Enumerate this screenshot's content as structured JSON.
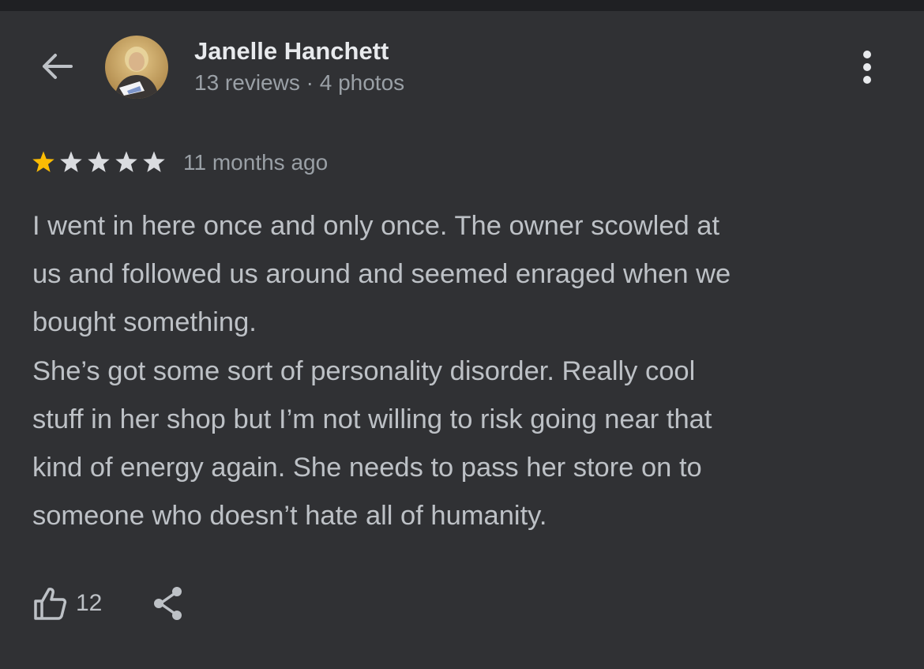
{
  "author": {
    "name": "Janelle Hanchett",
    "meta": "13 reviews · 4 photos"
  },
  "review": {
    "rating": 1,
    "max_rating": 5,
    "date": "11 months ago",
    "text": "I went in here once and only once. The owner scowled at\nus and followed us around and seemed enraged when we\nbought something.\nShe’s got some sort of personality disorder. Really cool\nstuff in her shop but I’m not willing to risk going near that\nkind of energy again. She needs to pass her store on to\nsomeone who doesn’t hate all of humanity."
  },
  "actions": {
    "like_count": "12"
  },
  "icons": {
    "back": "arrow-back-icon",
    "more": "more-vert-icon",
    "like": "thumb-up-icon",
    "share": "share-icon"
  },
  "colors": {
    "background": "#303134",
    "star_filled": "#fbbc04",
    "star_empty": "#dadce0",
    "primary_text": "#e8eaed",
    "secondary_text": "#9aa0a6",
    "body_text": "#bdc1c6"
  }
}
